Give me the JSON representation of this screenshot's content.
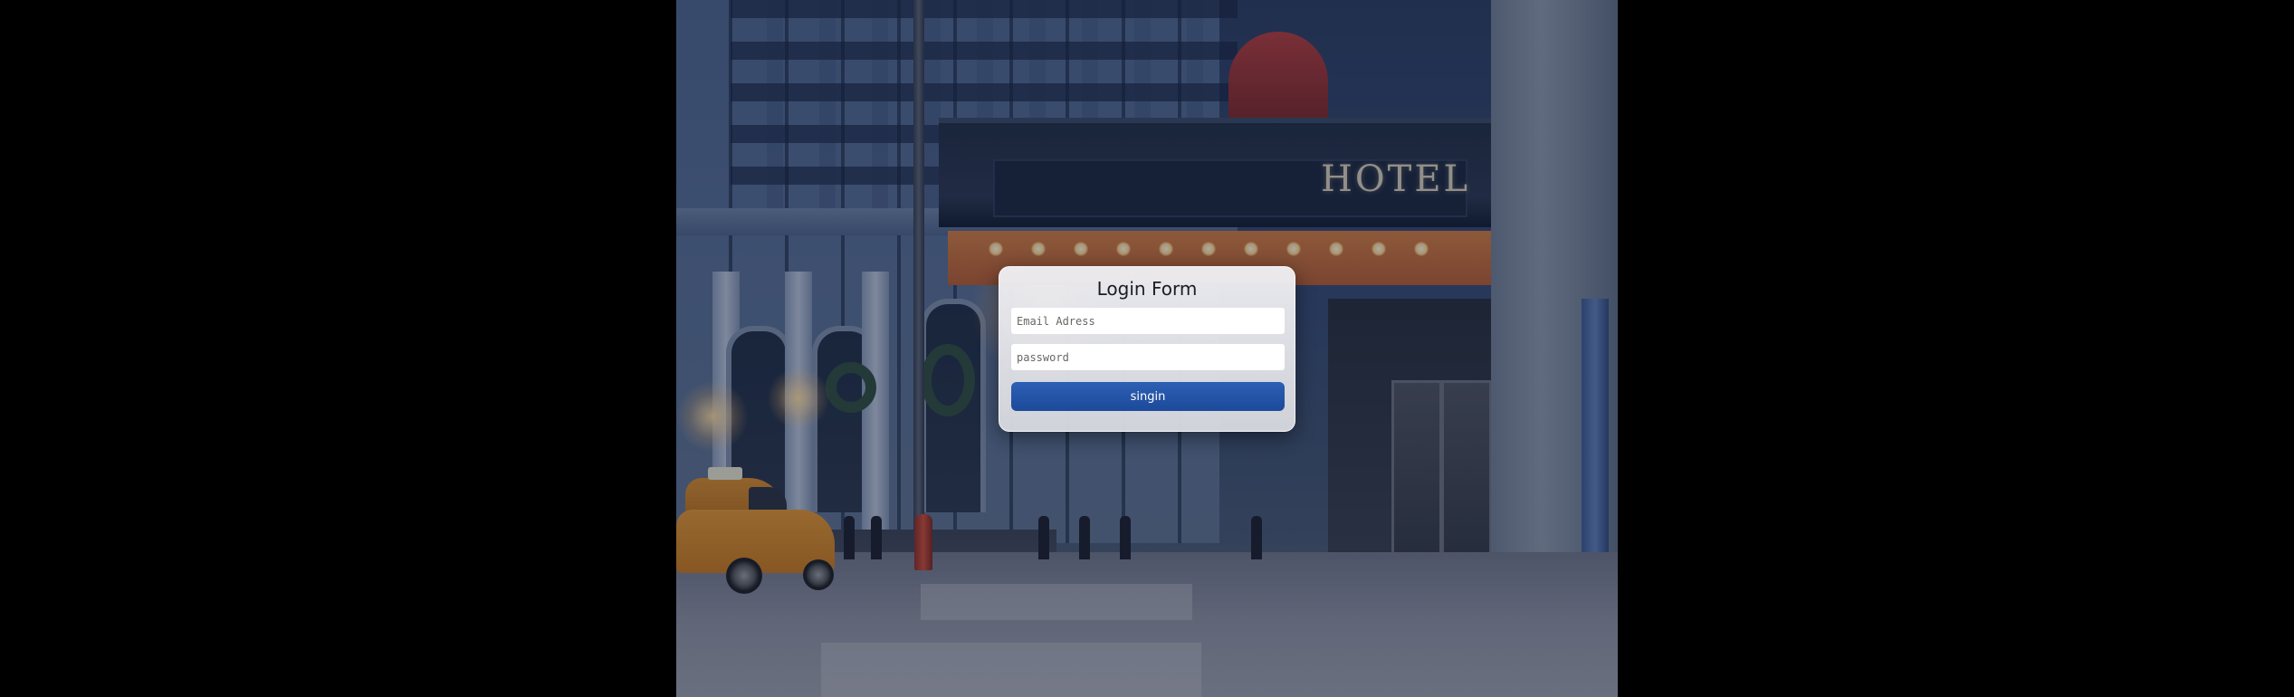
{
  "background": {
    "sign_text": "HOTEL",
    "description_colors": {
      "page_background": "#000000",
      "overlay": "#121e3c"
    }
  },
  "login": {
    "title": "Login Form",
    "email_placeholder": "Email Adress",
    "password_placeholder": "password",
    "submit_label": "singin",
    "button_color": "#2355a8"
  }
}
